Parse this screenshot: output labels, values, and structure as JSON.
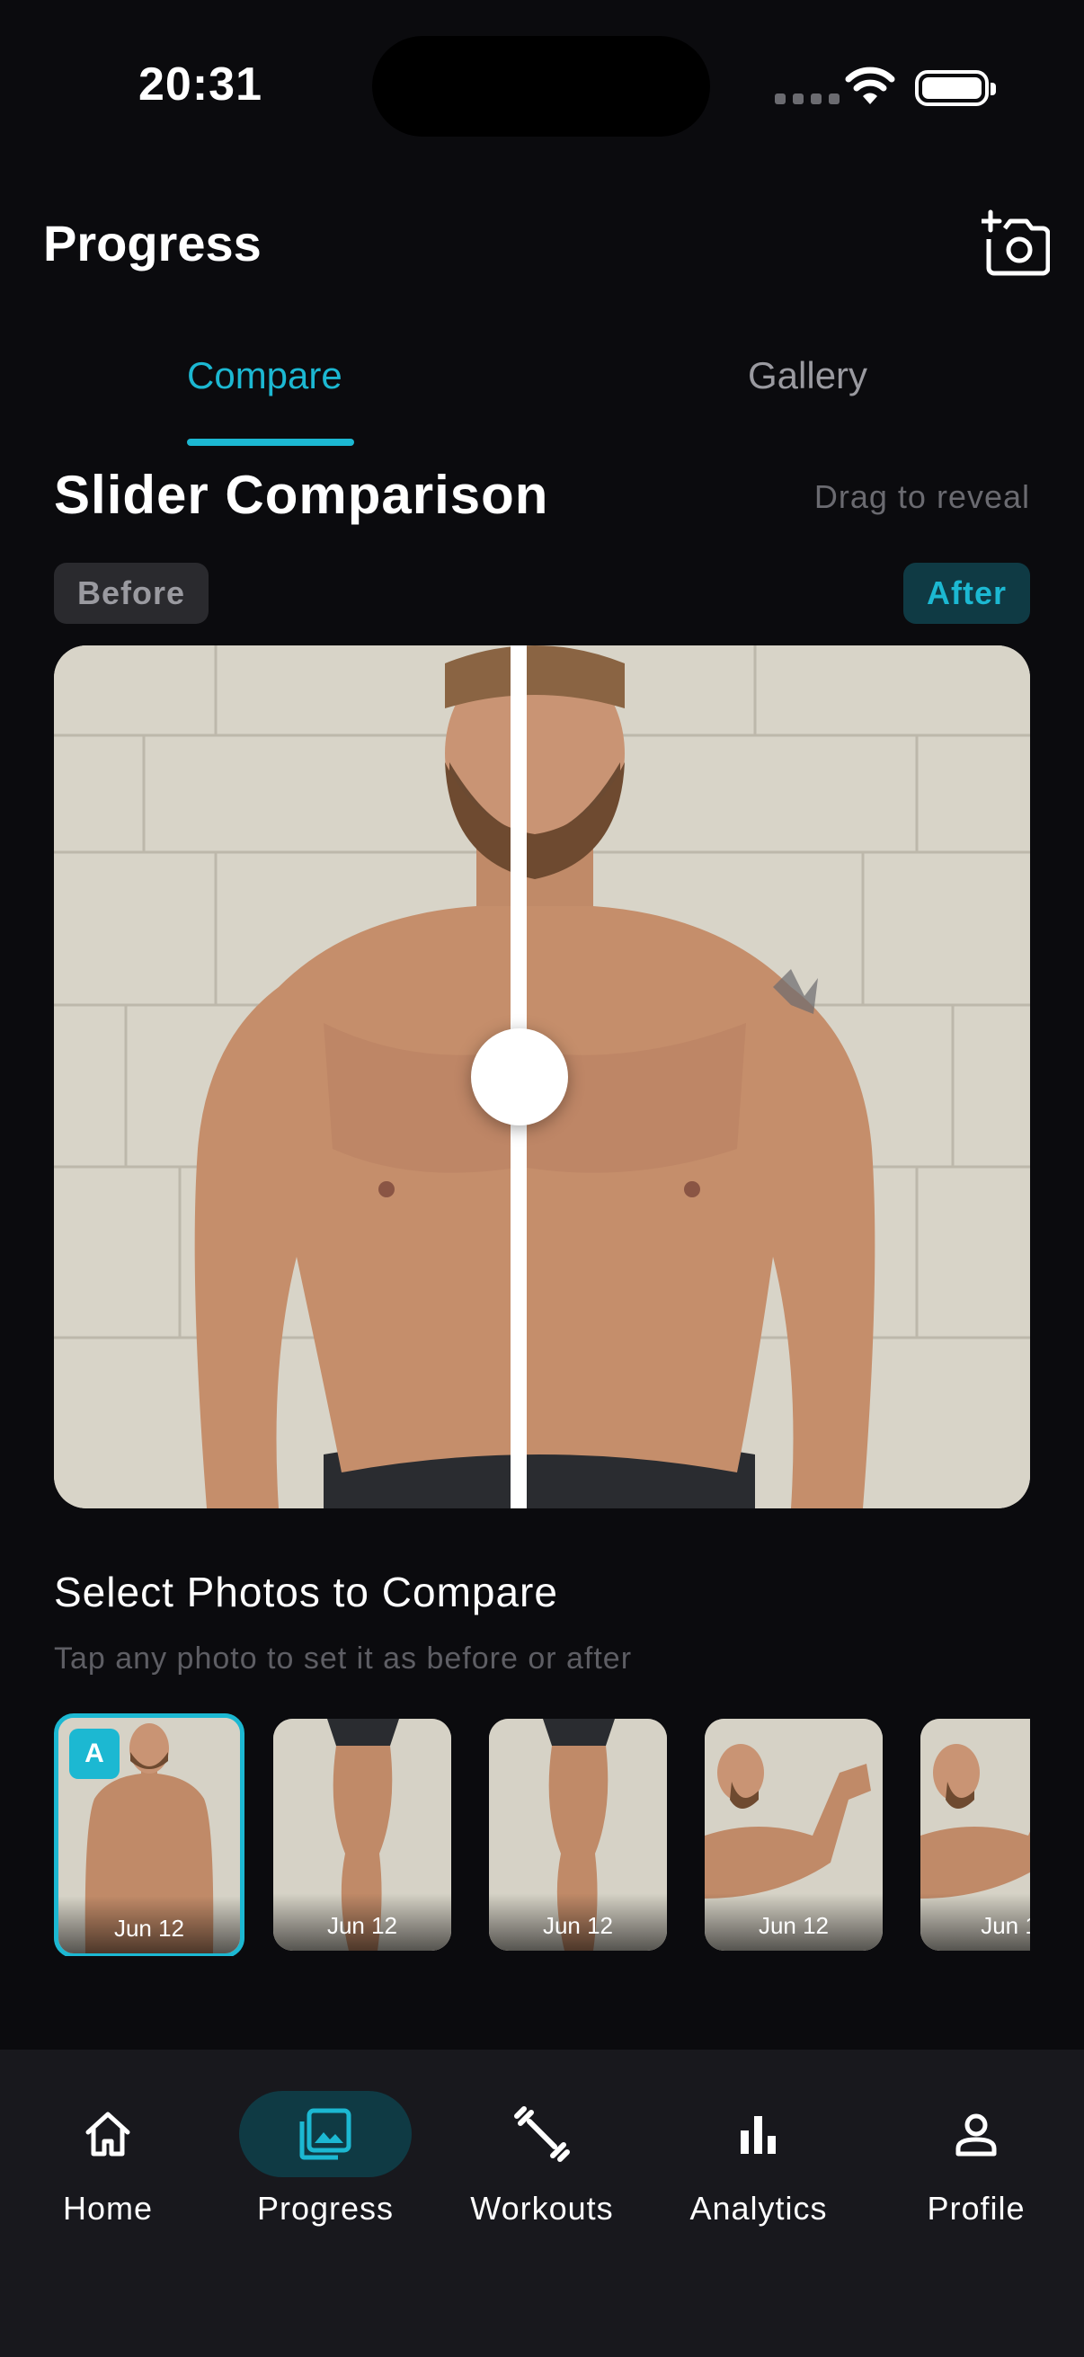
{
  "status": {
    "time": "20:31"
  },
  "header": {
    "title": "Progress",
    "camera_icon": "add-photo-camera-icon"
  },
  "tabs": [
    {
      "label": "Compare",
      "active": true
    },
    {
      "label": "Gallery",
      "active": false
    }
  ],
  "slider": {
    "title": "Slider Comparison",
    "hint": "Drag to reveal",
    "before_label": "Before",
    "after_label": "After",
    "position": 0.47
  },
  "select": {
    "title": "Select Photos to Compare",
    "hint": "Tap any photo to set it as before or after",
    "photos": [
      {
        "date": "Jun 12",
        "badge": "A",
        "selected": true,
        "pose": "front torso"
      },
      {
        "date": "Jun 12",
        "selected": false,
        "pose": "leg"
      },
      {
        "date": "Jun 12",
        "selected": false,
        "pose": "leg"
      },
      {
        "date": "Jun 12",
        "selected": false,
        "pose": "flex arm"
      },
      {
        "date": "Jun 1",
        "selected": false,
        "pose": "flex arm"
      }
    ]
  },
  "nav": [
    {
      "label": "Home",
      "icon": "home-icon",
      "active": false
    },
    {
      "label": "Progress",
      "icon": "photo-icon",
      "active": true
    },
    {
      "label": "Workouts",
      "icon": "dumbbell-icon",
      "active": false
    },
    {
      "label": "Analytics",
      "icon": "bar-chart-icon",
      "active": false
    },
    {
      "label": "Profile",
      "icon": "person-icon",
      "active": false
    }
  ],
  "colors": {
    "accent": "#1cb8d2",
    "background": "#0b0b0e",
    "nav_bg": "#18181d"
  }
}
